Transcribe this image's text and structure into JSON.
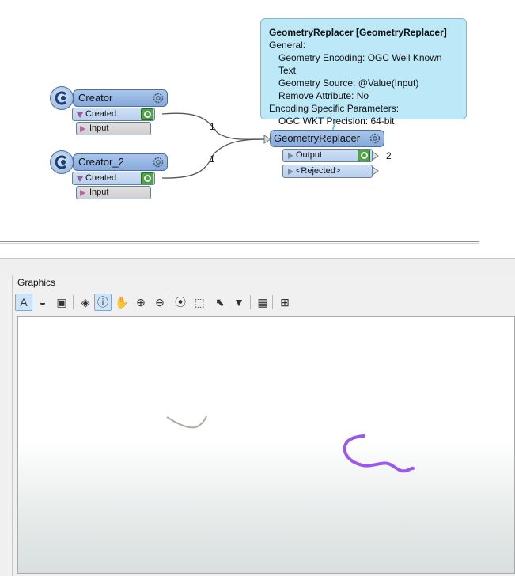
{
  "tooltip": {
    "title": "GeometryReplacer [GeometryReplacer]",
    "lines": [
      {
        "text": "General:",
        "indent": false
      },
      {
        "text": "Geometry Encoding: OGC Well Known Text",
        "indent": true
      },
      {
        "text": "Geometry Source: @Value(Input)",
        "indent": true
      },
      {
        "text": "Remove Attribute: No",
        "indent": true
      },
      {
        "text": "Encoding Specific Parameters:",
        "indent": false
      },
      {
        "text": "OGC WKT Precision: 64-bit",
        "indent": true
      }
    ]
  },
  "nodes": {
    "creator": {
      "name": "Creator",
      "out_port": "Created",
      "in_port": "Input"
    },
    "creator_2": {
      "name": "Creator_2",
      "out_port": "Created",
      "in_port": "Input"
    },
    "replacer": {
      "name": "GeometryReplacer",
      "out_port": "Output",
      "rejected_port": "<Rejected>"
    }
  },
  "connections": {
    "creator_count": "1",
    "creator_2_count": "1",
    "output_count": "2"
  },
  "panel": {
    "label": "Graphics"
  },
  "toolbar": {
    "buttons": [
      {
        "name": "select-tool",
        "glyph": "A",
        "active": true
      },
      {
        "name": "style-tool",
        "glyph": "◒",
        "active": false
      },
      {
        "name": "display-tool",
        "glyph": "▣",
        "active": false
      },
      {
        "name": "layers-tool",
        "glyph": "◈",
        "active": false
      },
      {
        "name": "identify-tool",
        "glyph": "ⓘ",
        "active": true
      },
      {
        "name": "pan-tool",
        "glyph": "✋",
        "active": false
      },
      {
        "name": "zoom-in-tool",
        "glyph": "⊕",
        "active": false
      },
      {
        "name": "zoom-out-tool",
        "glyph": "⊖",
        "active": false
      },
      {
        "name": "zoom-extent-tool",
        "glyph": "⦿",
        "active": false
      },
      {
        "name": "zoom-window-tool",
        "glyph": "⬚",
        "active": false
      },
      {
        "name": "select-features-tool",
        "glyph": "⬉",
        "active": false
      },
      {
        "name": "filter-tool",
        "glyph": "▼",
        "active": false
      },
      {
        "name": "table-tool",
        "glyph": "▦",
        "active": false
      },
      {
        "name": "add-geometry-tool",
        "glyph": "⊞",
        "active": false
      }
    ]
  },
  "colors": {
    "accent_line": "#b0aba0",
    "accent_purple": "#9b59ec"
  }
}
